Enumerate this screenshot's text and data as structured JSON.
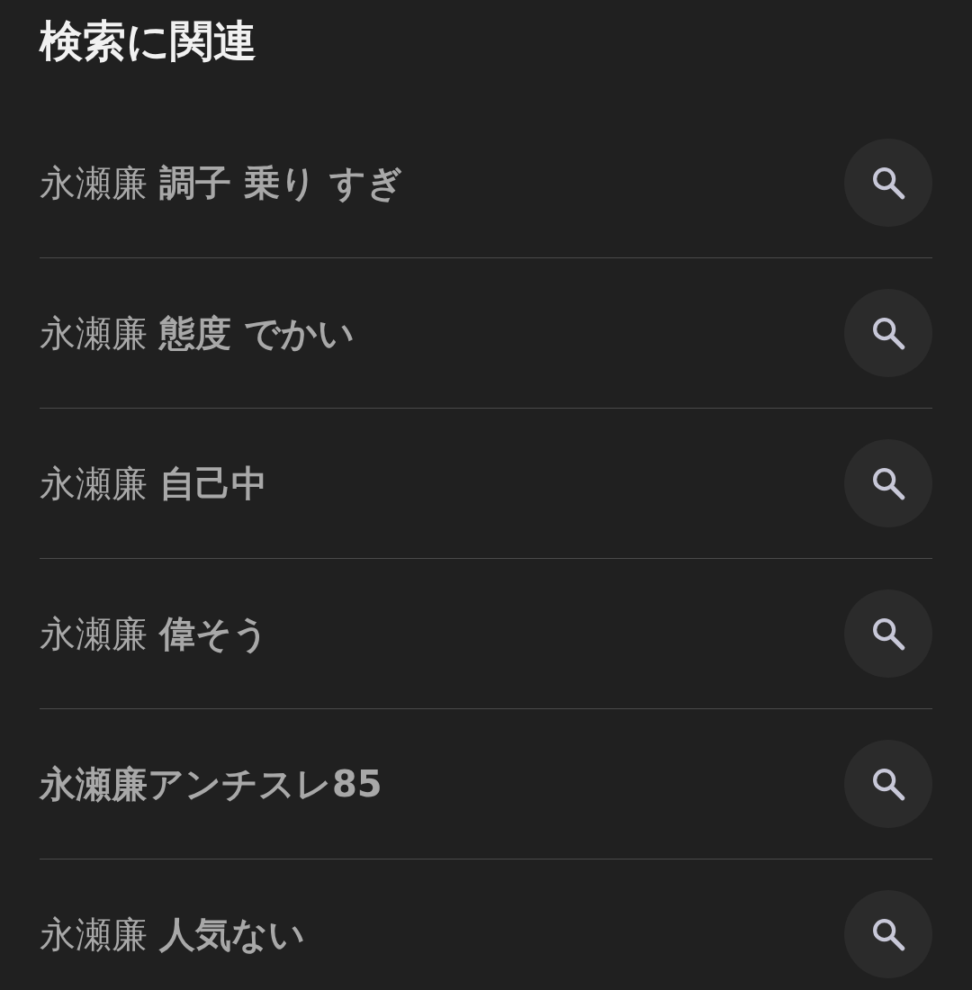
{
  "title": "検索に関連",
  "suggestions": [
    {
      "text": "永瀬廉 **調子 乗り すぎ**"
    },
    {
      "text": "永瀬廉 **態度 でかい**"
    },
    {
      "text": "永瀬廉 **自己中**"
    },
    {
      "text": "永瀬廉 **偉そう**"
    },
    {
      "text": "**永瀬廉アンチスレ85**"
    },
    {
      "text": "永瀬廉 **人気ない**"
    }
  ]
}
